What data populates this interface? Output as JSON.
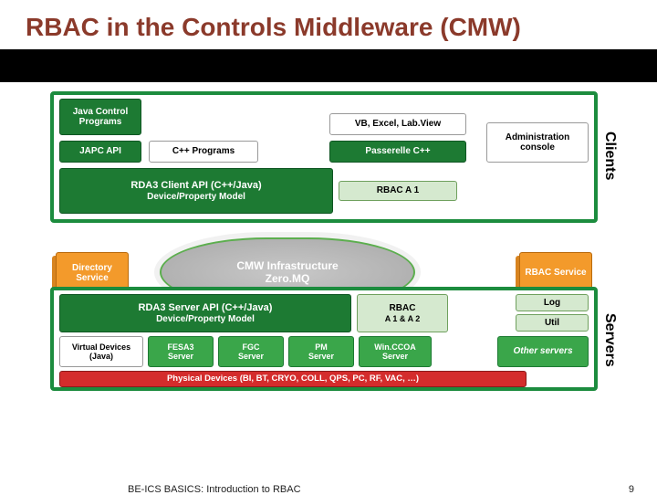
{
  "title": "RBAC in the Controls Middleware (CMW)",
  "labels": {
    "clients": "Clients",
    "servers": "Servers"
  },
  "clients": {
    "javaControl": "Java Control Programs",
    "japc": "JAPC API",
    "cpp": "C++ Programs",
    "vb": "VB, Excel, Lab.View",
    "passerelle": "Passerelle C++",
    "admin": "Administration console",
    "rda3_l1": "RDA3 Client API (C++/Java)",
    "rda3_l2": "Device/Property Model",
    "rbacA1": "RBAC A 1"
  },
  "middle": {
    "directory": "Directory Service",
    "cmw_l1": "CMW Infrastructure",
    "cmw_l2": "Zero.MQ",
    "rbacService": "RBAC Service"
  },
  "servers": {
    "rda3s_l1": "RDA3 Server API (C++/Java)",
    "rda3s_l2": "Device/Property Model",
    "rbac12_l1": "RBAC",
    "rbac12_l2": "A 1 & A 2",
    "log": "Log",
    "util": "Util",
    "vd_l1": "Virtual Devices",
    "vd_l2": "(Java)",
    "fesa_l1": "FESA3",
    "fesa_l2": "Server",
    "fgc_l1": "FGC",
    "fgc_l2": "Server",
    "pm_l1": "PM",
    "pm_l2": "Server",
    "wccoa_l1": "Win.CCOA",
    "wccoa_l2": "Server",
    "other": "Other servers",
    "physical": "Physical Devices (BI, BT, CRYO, COLL, QPS, PC, RF, VAC, …)"
  },
  "footer": {
    "left": "BE-ICS BASICS: Introduction to RBAC",
    "page": "9"
  }
}
